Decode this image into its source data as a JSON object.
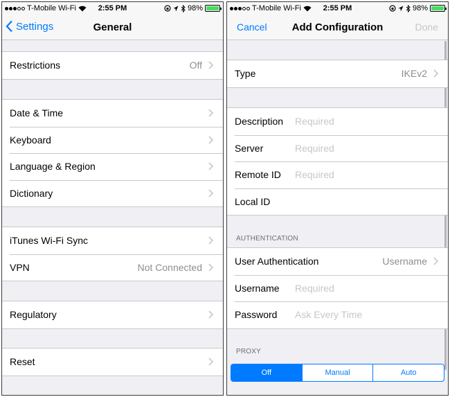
{
  "status_bar": {
    "carrier": "T-Mobile Wi-Fi",
    "time": "2:55 PM",
    "battery": "98%",
    "battery_level": 0.98
  },
  "left": {
    "nav": {
      "back_label": "Settings",
      "title": "General"
    },
    "groups": [
      {
        "rows": [
          {
            "label": "Restrictions",
            "value": "Off"
          }
        ]
      },
      {
        "rows": [
          {
            "label": "Date & Time"
          },
          {
            "label": "Keyboard"
          },
          {
            "label": "Language & Region"
          },
          {
            "label": "Dictionary"
          }
        ]
      },
      {
        "rows": [
          {
            "label": "iTunes Wi-Fi Sync"
          },
          {
            "label": "VPN",
            "value": "Not Connected"
          }
        ]
      },
      {
        "rows": [
          {
            "label": "Regulatory"
          }
        ]
      },
      {
        "rows": [
          {
            "label": "Reset"
          }
        ]
      }
    ]
  },
  "right": {
    "nav": {
      "cancel_label": "Cancel",
      "title": "Add Configuration",
      "done_label": "Done"
    },
    "type_row": {
      "label": "Type",
      "value": "IKEv2"
    },
    "fields": [
      {
        "label": "Description",
        "placeholder": "Required"
      },
      {
        "label": "Server",
        "placeholder": "Required"
      },
      {
        "label": "Remote ID",
        "placeholder": "Required"
      },
      {
        "label": "Local ID",
        "placeholder": ""
      }
    ],
    "authentication_header": "AUTHENTICATION",
    "auth_rows": [
      {
        "label": "User Authentication",
        "value": "Username"
      },
      {
        "label": "Username",
        "placeholder": "Required"
      },
      {
        "label": "Password",
        "placeholder": "Ask Every Time"
      }
    ],
    "proxy_header": "PROXY",
    "proxy_options": [
      "Off",
      "Manual",
      "Auto"
    ],
    "proxy_selected": "Off"
  },
  "colors": {
    "accent": "#007aff",
    "background": "#efeff4",
    "separator": "#c8c7cc",
    "secondary_text": "#8e8e93",
    "placeholder": "#c7c7cc",
    "battery": "#4cd964"
  },
  "icons": [
    "signal-dots-icon",
    "wifi-icon",
    "lock-rotation-icon",
    "location-icon",
    "bluetooth-icon",
    "charging-icon",
    "battery-icon",
    "chevron-left-icon",
    "chevron-right-icon"
  ]
}
